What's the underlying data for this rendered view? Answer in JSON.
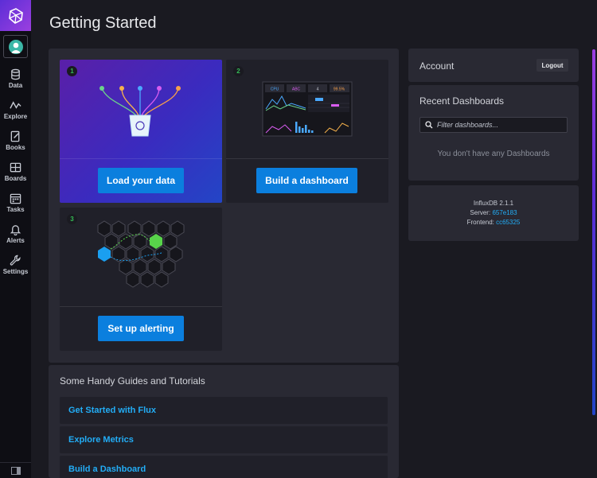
{
  "sidebar": {
    "items": [
      {
        "label": "Data",
        "icon": "database-icon"
      },
      {
        "label": "Explore",
        "icon": "graph-line-icon"
      },
      {
        "label": "Books",
        "icon": "notebook-icon"
      },
      {
        "label": "Boards",
        "icon": "dashboard-grid-icon"
      },
      {
        "label": "Tasks",
        "icon": "calendar-icon"
      },
      {
        "label": "Alerts",
        "icon": "bell-icon"
      },
      {
        "label": "Settings",
        "icon": "wrench-icon"
      }
    ]
  },
  "page": {
    "title": "Getting Started"
  },
  "steps": [
    {
      "number": "1",
      "button": "Load your data"
    },
    {
      "number": "2",
      "button": "Build a dashboard"
    },
    {
      "number": "3",
      "button": "Set up alerting"
    }
  ],
  "dashboard_preview": {
    "cells": [
      "CPU",
      "ABC",
      "4",
      "99.5%"
    ]
  },
  "guides": {
    "title": "Some Handy Guides and Tutorials",
    "items": [
      "Get Started with Flux",
      "Explore Metrics",
      "Build a Dashboard"
    ]
  },
  "account": {
    "title": "Account",
    "logout": "Logout"
  },
  "recent": {
    "title": "Recent Dashboards",
    "placeholder": "Filter dashboards...",
    "empty": "You don't have any Dashboards"
  },
  "version": {
    "product": "InfluxDB 2.1.1",
    "server_label": "Server:",
    "server_hash": "657e183",
    "frontend_label": "Frontend:",
    "frontend_hash": "cc65325"
  },
  "colors": {
    "accent": "#0b7fde",
    "link": "#22adf6",
    "success": "#34bb55",
    "brand": "#5c2ed6"
  }
}
